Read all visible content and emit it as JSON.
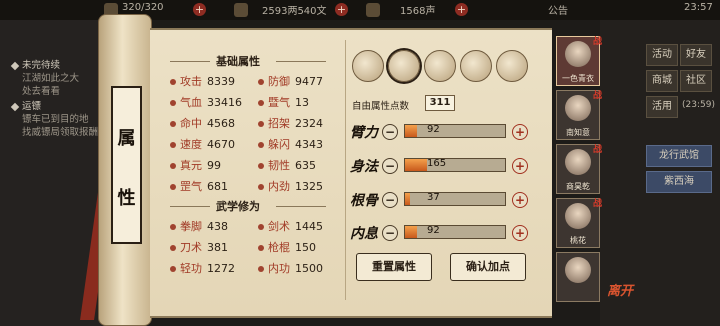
{
  "topbar": {
    "stamina": "320/320",
    "money": "2593两540文",
    "reputation": "1568声",
    "notice": "公告",
    "time": "23:57"
  },
  "quest_panel": {
    "items": [
      {
        "title": "未完待续",
        "desc": [
          "江湖如此之大",
          "处去看看"
        ]
      },
      {
        "title": "运镖",
        "desc": [
          "镖车已到目的地",
          "找威镖局领取报酬"
        ]
      }
    ]
  },
  "side_menu": {
    "buttons": [
      "活动",
      "好友",
      "商城",
      "社区",
      "活用",
      "(23:59)",
      "龙行武馆",
      "紫西海"
    ]
  },
  "scroll": {
    "title_chars": [
      "属",
      "性"
    ]
  },
  "basic_attributes": {
    "title": "基础属性",
    "stats": [
      {
        "name": "攻击",
        "value": "8339"
      },
      {
        "name": "防御",
        "value": "9477"
      },
      {
        "name": "气血",
        "value": "33416"
      },
      {
        "name": "暨气",
        "value": "13"
      },
      {
        "name": "命中",
        "value": "4568"
      },
      {
        "name": "招架",
        "value": "2324"
      },
      {
        "name": "速度",
        "value": "4670"
      },
      {
        "name": "躲闪",
        "value": "4343"
      },
      {
        "name": "真元",
        "value": "99"
      },
      {
        "name": "韧性",
        "value": "635"
      },
      {
        "name": "罡气",
        "value": "681"
      },
      {
        "name": "内劲",
        "value": "1325"
      }
    ]
  },
  "martial_arts": {
    "title": "武学修为",
    "stats": [
      {
        "name": "拳脚",
        "value": "438"
      },
      {
        "name": "剑术",
        "value": "1445"
      },
      {
        "name": "刀术",
        "value": "381"
      },
      {
        "name": "枪棍",
        "value": "150"
      },
      {
        "name": "轻功",
        "value": "1272"
      },
      {
        "name": "内功",
        "value": "1500"
      }
    ]
  },
  "allocation": {
    "free_points_label": "自由属性点数",
    "free_points": "311",
    "rows": [
      {
        "label": "臂力",
        "value": "92",
        "progress": 0.12
      },
      {
        "label": "身法",
        "value": "165",
        "progress": 0.22
      },
      {
        "label": "根骨",
        "value": "37",
        "progress": 0.05
      },
      {
        "label": "内息",
        "value": "92",
        "progress": 0.12
      }
    ],
    "reset_label": "重置属性",
    "confirm_label": "确认加点"
  },
  "characters": [
    {
      "name": "一色青衣",
      "badge": "战"
    },
    {
      "name": "南知意",
      "badge": "战"
    },
    {
      "name": "商昊乾",
      "badge": "战"
    },
    {
      "name": "桃花",
      "badge": "战"
    },
    {
      "name": "",
      "badge": ""
    }
  ],
  "leave_label": "离开"
}
